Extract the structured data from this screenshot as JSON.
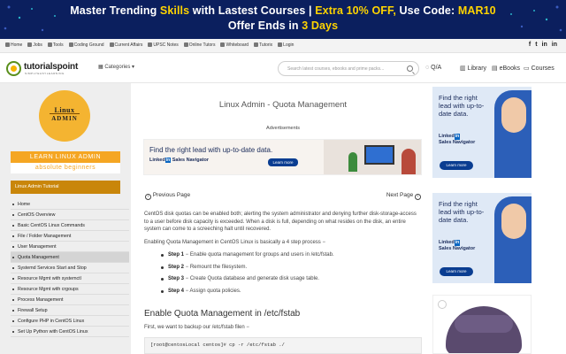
{
  "promo": {
    "line1": [
      {
        "text": "Master Trending ",
        "hl": false
      },
      {
        "text": "Skills",
        "hl": true
      },
      {
        "text": " with Lastest Courses | ",
        "hl": false
      },
      {
        "text": "Extra 10% OFF,",
        "hl": true
      },
      {
        "text": " Use Code: ",
        "hl": false
      },
      {
        "text": "MAR10",
        "hl": true
      }
    ],
    "line2": [
      {
        "text": "Offer Ends in ",
        "hl": false
      },
      {
        "text": "3 Days",
        "hl": true
      }
    ],
    "bg_color": "#0b1f5e",
    "highlight_color": "#ffd400"
  },
  "topnav": {
    "links": [
      "Home",
      "Jobs",
      "Tools",
      "Coding Ground",
      "Current Affairs",
      "UPSC Notes",
      "Online Tutors",
      "Whiteboard",
      "Tutorix",
      "Login"
    ],
    "social": [
      "f",
      "t",
      "in",
      "in"
    ]
  },
  "header": {
    "logo_text": "tutorialspoint",
    "logo_tagline": "SIMPLYEASYLEARNING",
    "categories_label": "Categories",
    "search_placeholder": "Search latest courses, ebooks and prime packs...",
    "nav": [
      {
        "icon": "qa-icon",
        "glyph": "◌",
        "label": "Q/A"
      },
      {
        "icon": "library-icon",
        "glyph": "▥",
        "label": "Library"
      },
      {
        "icon": "ebooks-icon",
        "glyph": "▤",
        "label": "eBooks"
      },
      {
        "icon": "courses-icon",
        "glyph": "▭",
        "label": "Courses"
      }
    ]
  },
  "sidebar": {
    "logo_line1": "Linux",
    "logo_line2": "ADMIN",
    "learn_label": "LEARN LINUX ADMIN",
    "beginners_label": "absolute beginners",
    "tutorial_heading": "Linux Admin Tutorial",
    "items": [
      {
        "label": "Home",
        "active": false
      },
      {
        "label": "CentOS Overview",
        "active": false
      },
      {
        "label": "Basic CentOS Linux Commands",
        "active": false
      },
      {
        "label": "File / Folder Management",
        "active": false
      },
      {
        "label": "User Management",
        "active": false
      },
      {
        "label": "Quota Management",
        "active": true
      },
      {
        "label": "Systemd Services Start and Stop",
        "active": false
      },
      {
        "label": "Resource Mgmt with systemctl",
        "active": false
      },
      {
        "label": "Resource Mgmt with crgoups",
        "active": false
      },
      {
        "label": "Process Management",
        "active": false
      },
      {
        "label": "Firewall Setup",
        "active": false
      },
      {
        "label": "Configure PHP in CentOS Linux",
        "active": false
      },
      {
        "label": "Set Up Python with CentOS Linux",
        "active": false
      }
    ]
  },
  "main": {
    "title": "Linux Admin - Quota Management",
    "ads_label": "Advertisements",
    "ad": {
      "headline": "Find the right lead with up-to-date data.",
      "brand_box": "in",
      "brand_text": "Linked",
      "product": "Sales Navigator",
      "cta": "Learn more"
    },
    "prev_label": "Previous Page",
    "next_label": "Next Page",
    "para1": "CentOS disk quotas can be enabled both; alerting the system administrator and denying further disk-storage-access to a user before disk capacity is exceeded. When a disk is full, depending on what resides on the disk, an entire system can come to a screeching halt until recovered.",
    "para2": "Enabling Quota Management in CentOS Linux is basically a 4 step process −",
    "steps": [
      {
        "label": "Step 1",
        "text": " − Enable quota management for groups and users in /etc/fstab."
      },
      {
        "label": "Step 2",
        "text": " − Remount the filesystem."
      },
      {
        "label": "Step 3",
        "text": " − Create Quota database and generate disk usage table."
      },
      {
        "label": "Step 4",
        "text": " − Assign quota policies."
      }
    ],
    "section_heading": "Enable Quota Management in /etc/fstab",
    "para3": "First, we want to backup our /etc/fstab filen −",
    "code": "[root@centosLocal centos]# cp -r /etc/fstab ./"
  },
  "right_ads": {
    "headline": "Find the right lead with up-to-date data.",
    "brand_text": "Linked",
    "brand_box": "in",
    "product": "Sales Navigator",
    "cta": "Learn more"
  }
}
